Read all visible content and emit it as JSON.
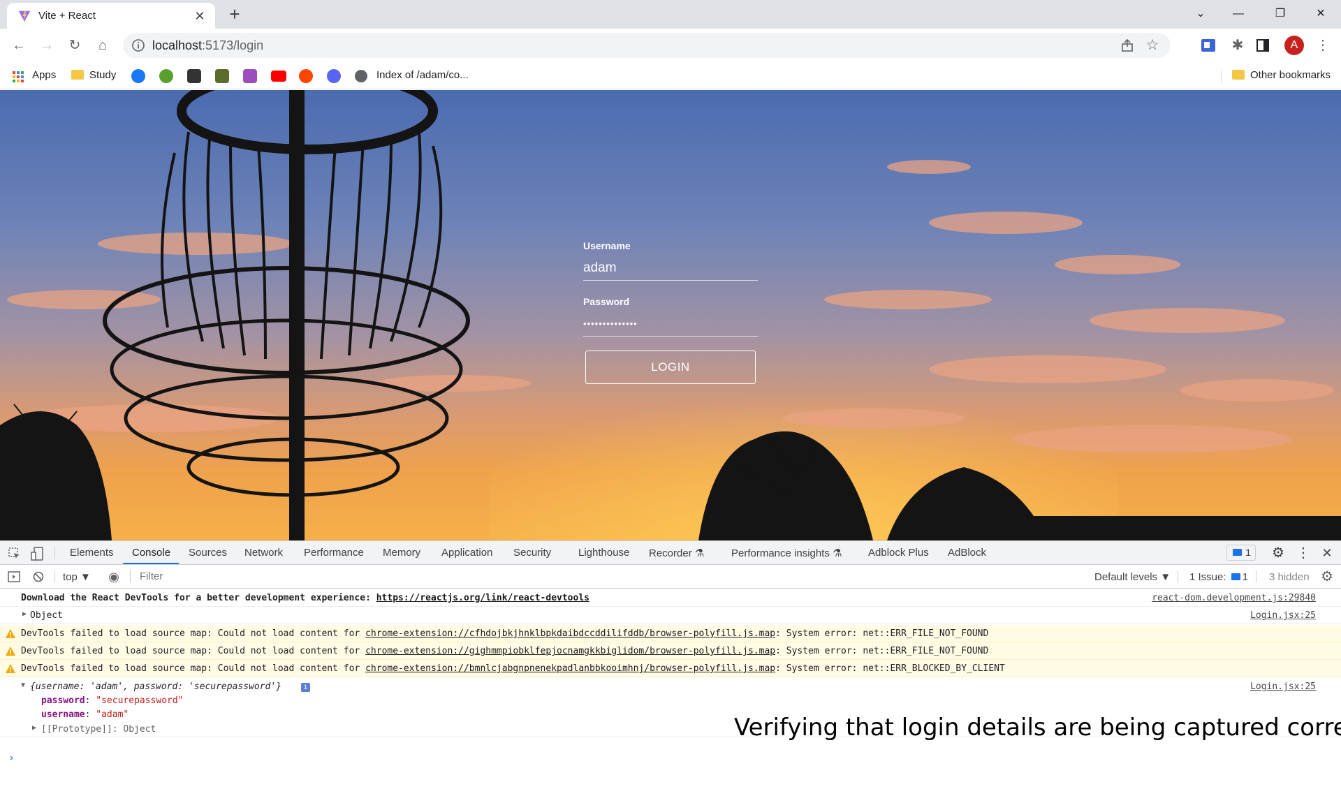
{
  "tab": {
    "title": "Vite + React",
    "close": "✕",
    "new_tab": "+"
  },
  "window": {
    "chevron": "⌄",
    "minimize": "—",
    "restore": "❐",
    "close": "✕"
  },
  "toolbar": {
    "url_host": "localhost",
    "url_path": ":5173/login",
    "avatar_letter": "A"
  },
  "bookmarks": {
    "apps": "Apps",
    "study": "Study",
    "index": "Index of /adam/co...",
    "other": "Other bookmarks"
  },
  "login": {
    "username_label": "Username",
    "username_value": "adam",
    "password_label": "Password",
    "password_value": "••••••••••••••",
    "button_label": "LOGIN"
  },
  "devtools": {
    "tabs": [
      "Elements",
      "Console",
      "Sources",
      "Network",
      "Performance",
      "Memory",
      "Application",
      "Security",
      "Lighthouse",
      "Recorder ⚗",
      "Performance insights ⚗",
      "Adblock Plus",
      "AdBlock"
    ],
    "issues_badge": "1",
    "context": "top ▼",
    "filter_placeholder": "Filter",
    "levels": "Default levels ▼",
    "issue_count": "1 Issue:",
    "issue_badge": "1",
    "hidden": "3 hidden"
  },
  "console": {
    "row1_msg": "Download the React DevTools for a better development experience: ",
    "row1_link": "https://reactjs.org/link/react-devtools",
    "row1_src": "react-dom.development.js:29840",
    "row2_msg": "Object",
    "row2_src": "Login.jsx:25",
    "warn_prefix": "DevTools failed to load source map: Could not load content for ",
    "warn1_link": "chrome-extension://cfhdojbkjhnklbpkdaibdccddilifddb/browser-polyfill.js.map",
    "warn1_suffix": ": System error: net::ERR_FILE_NOT_FOUND",
    "warn2_link": "chrome-extension://gighmmpiobklfepjocnamgkkbiglidom/browser-polyfill.js.map",
    "warn2_suffix": ": System error: net::ERR_FILE_NOT_FOUND",
    "warn3_link": "chrome-extension://bmnlcjabgnpnenekpadlanbbkooimhnj/browser-polyfill.js.map",
    "warn3_suffix": ": System error: net::ERR_BLOCKED_BY_CLIENT",
    "obj_summary": "{username: 'adam', password: 'securepassword'}",
    "obj_src": "Login.jsx:25",
    "prop_password_key": "password",
    "prop_password_val": "\"securepassword\"",
    "prop_username_key": "username",
    "prop_username_val": "\"adam\"",
    "prototype": "[[Prototype]]: Object",
    "prompt": "›"
  },
  "caption": "Verifying that login details are being captured correctly.",
  "colors": {
    "accent": "#1a73e8",
    "warn_bg": "#fffbe5",
    "avatar": "#c5221f"
  }
}
